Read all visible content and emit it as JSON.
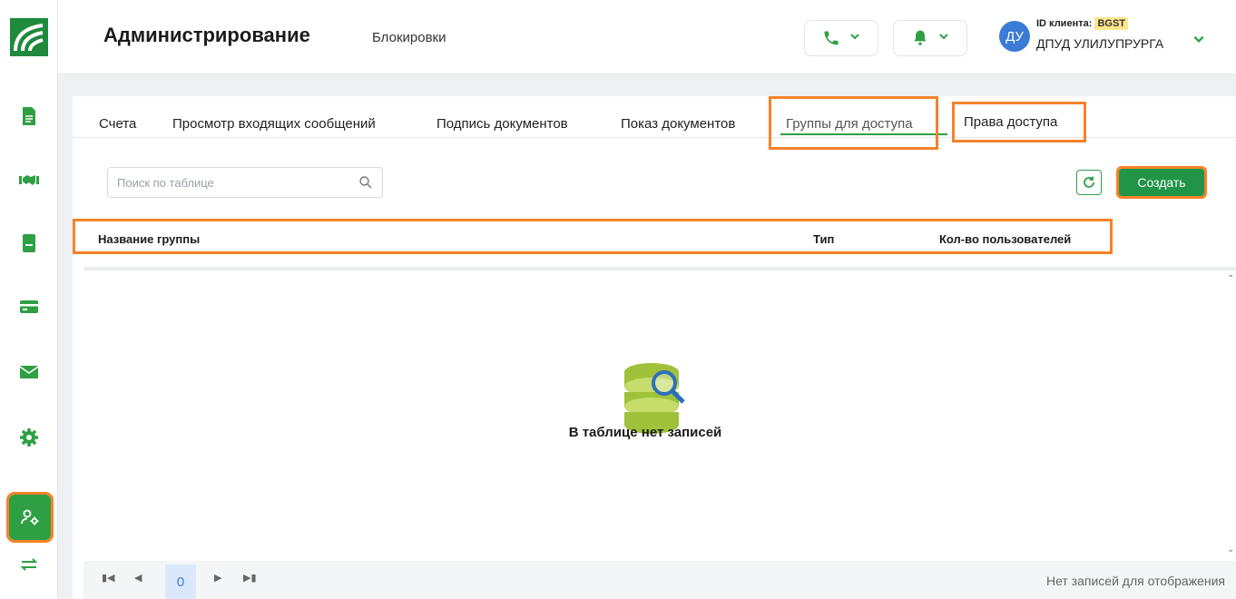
{
  "header": {
    "title": "Администрирование",
    "subtitle": "Блокировки",
    "client_id_label": "ID клиента:",
    "client_id": "BGST",
    "user_initials": "ДУ",
    "user_name": "ДПУД УЛИЛУПРУРГА"
  },
  "sidebar": {
    "items": [
      {
        "icon": "document-icon"
      },
      {
        "icon": "handshake-icon"
      },
      {
        "icon": "book-icon"
      },
      {
        "icon": "card-icon"
      },
      {
        "icon": "mail-icon"
      },
      {
        "icon": "gear-icon"
      },
      {
        "icon": "user-settings-icon",
        "active": true
      },
      {
        "icon": "transfer-icon"
      }
    ]
  },
  "tabs": [
    {
      "label": "Счета"
    },
    {
      "label": "Просмотр входящих сообщений"
    },
    {
      "label": "Подпись документов"
    },
    {
      "label": "Показ документов"
    },
    {
      "label": "Группы для доступа",
      "active": true
    },
    {
      "label": "Права доступа"
    }
  ],
  "toolbar": {
    "search_placeholder": "Поиск по таблице",
    "create_label": "Создать"
  },
  "table": {
    "columns": [
      "Название группы",
      "Тип",
      "Кол-во пользователей"
    ],
    "empty_message": "В таблице нет записей"
  },
  "pager": {
    "current_page": "0",
    "status": "Нет записей для отображения"
  },
  "colors": {
    "accent": "#2ea043",
    "highlight": "#f5822a",
    "avatar": "#3a7bd5"
  }
}
